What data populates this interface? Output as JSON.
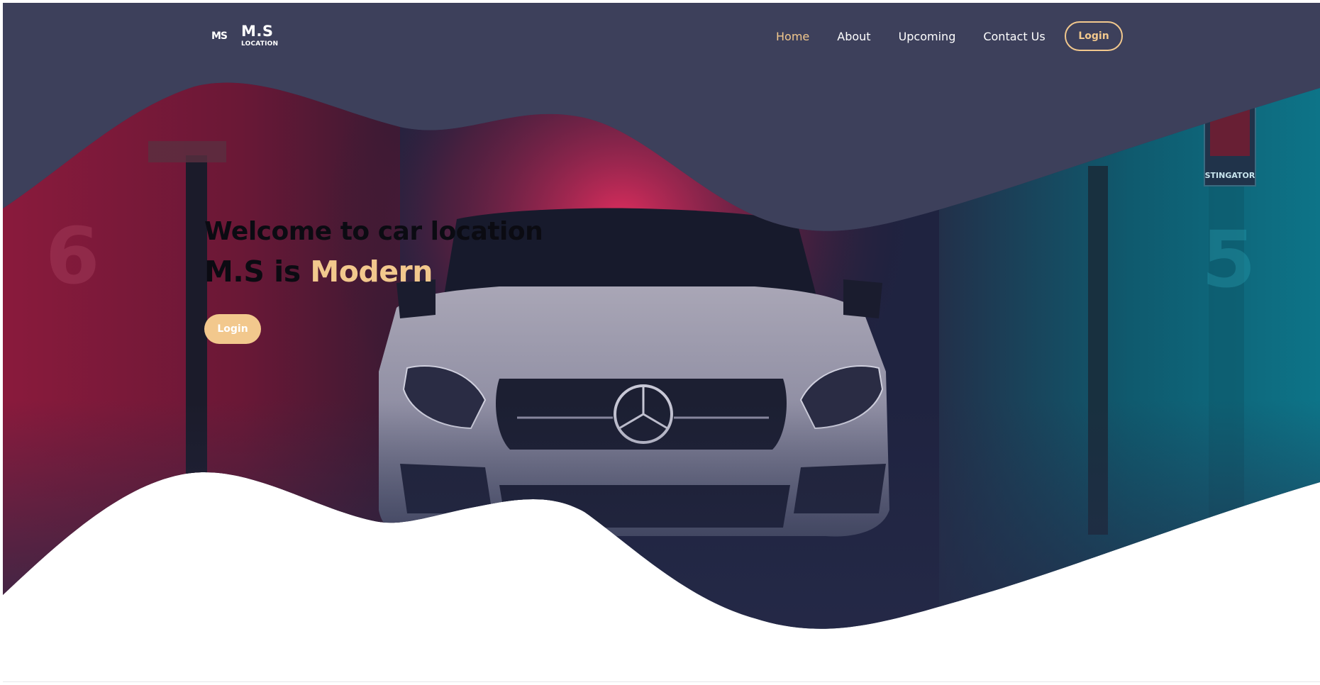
{
  "brand": {
    "mark": "MS",
    "title": "M.S",
    "subtitle": "LOCATION"
  },
  "nav": {
    "items": [
      {
        "label": "Home",
        "active": true
      },
      {
        "label": "About",
        "active": false
      },
      {
        "label": "Upcoming",
        "active": false
      },
      {
        "label": "Contact Us",
        "active": false
      }
    ],
    "login_label": "Login"
  },
  "hero": {
    "line1": "Welcome to car location",
    "line2_prefix": "M.S is ",
    "line2_accent": "Modern",
    "login_label": "Login",
    "sign_text": "STINGATOR",
    "wall_number_left": "6",
    "wall_number_right": "5"
  },
  "colors": {
    "navy": "#3d405b",
    "accent": "#f2c88d",
    "text_dark": "#0b0b12",
    "white": "#ffffff"
  }
}
